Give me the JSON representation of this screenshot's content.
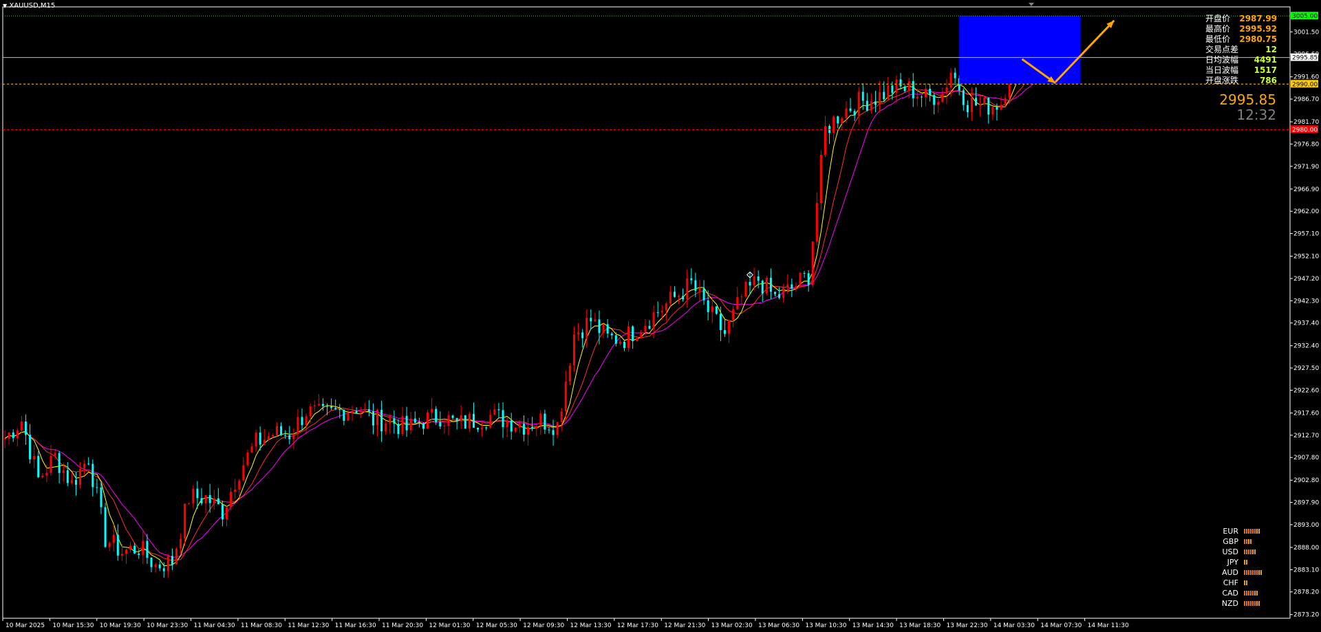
{
  "window": {
    "symbol_label": "XAUUSD,M15"
  },
  "colors": {
    "background": "#000000",
    "bull_candle": "#ff0000",
    "bear_candle": "#00ffff",
    "ma_fast": "#ffff00",
    "ma_mid": "#ff3030",
    "ma_slow": "#ff00ff",
    "axis": "#ffffff",
    "target_box": "#0000ff",
    "arrow": "#ffa500",
    "upper_level": "#00ff00",
    "mid_level": "#ffcc00",
    "lower_level": "#ff0000",
    "bid_line": "#c0c0c0"
  },
  "info_panel": [
    {
      "label": "开盘价",
      "value": "2987.99",
      "color": "#ffa500"
    },
    {
      "label": "最高价",
      "value": "2995.92",
      "color": "#ffa500"
    },
    {
      "label": "最低价",
      "value": "2980.75",
      "color": "#ffa500"
    },
    {
      "label": "交易点差",
      "value": "12",
      "color": "#ccff33"
    },
    {
      "label": "日均波幅",
      "value": "4491",
      "color": "#ccff33"
    },
    {
      "label": "当日波幅",
      "value": "1517",
      "color": "#ccff33"
    },
    {
      "label": "开盘涨跌",
      "value": "786",
      "color": "#ccff33"
    }
  ],
  "current_price": "2995.85",
  "countdown": "12:32",
  "currency_strength": [
    {
      "name": "EUR",
      "bars": 8
    },
    {
      "name": "GBP",
      "bars": 4
    },
    {
      "name": "USD",
      "bars": 6
    },
    {
      "name": "JPY",
      "bars": 2
    },
    {
      "name": "AUD",
      "bars": 9
    },
    {
      "name": "CHF",
      "bars": 2
    },
    {
      "name": "CAD",
      "bars": 7
    },
    {
      "name": "NZD",
      "bars": 8
    }
  ],
  "chart_data": {
    "type": "candlestick",
    "symbol": "XAUUSD",
    "timeframe": "M15",
    "ylim": [
      2872.4,
      3007.0
    ],
    "y_ticks": [
      "3001.50",
      "2996.60",
      "2991.60",
      "2986.70",
      "2981.70",
      "2976.80",
      "2971.90",
      "2966.90",
      "2962.00",
      "2957.10",
      "2952.10",
      "2947.20",
      "2942.30",
      "2937.40",
      "2932.40",
      "2927.50",
      "2922.60",
      "2917.60",
      "2912.70",
      "2907.80",
      "2902.80",
      "2897.90",
      "2893.00",
      "2888.00",
      "2883.10",
      "2878.20",
      "2873.20"
    ],
    "x_ticks": [
      "10 Mar 2025",
      "10 Mar 15:30",
      "10 Mar 19:30",
      "10 Mar 23:30",
      "11 Mar 04:30",
      "11 Mar 08:30",
      "11 Mar 12:30",
      "11 Mar 16:30",
      "11 Mar 20:30",
      "12 Mar 01:30",
      "12 Mar 05:30",
      "12 Mar 09:30",
      "12 Mar 13:30",
      "12 Mar 17:30",
      "12 Mar 21:30",
      "13 Mar 02:30",
      "13 Mar 06:30",
      "13 Mar 10:30",
      "13 Mar 14:30",
      "13 Mar 18:30",
      "13 Mar 22:30",
      "14 Mar 03:30",
      "14 Mar 07:30",
      "14 Mar 11:30"
    ],
    "levels": [
      {
        "name": "upper",
        "value": 3005.0,
        "label": "3005.00",
        "style": "dotted"
      },
      {
        "name": "bid",
        "value": 2995.85,
        "label": "2995.85",
        "style": "solid"
      },
      {
        "name": "mid",
        "value": 2990.0,
        "label": "2990.00",
        "style": "dashed"
      },
      {
        "name": "lower",
        "value": 2980.0,
        "label": "2980.00",
        "style": "dashed"
      }
    ],
    "target_box": {
      "bar_from": 228,
      "bar_to": 257,
      "price_low": 2990.0,
      "price_high": 3005.0
    },
    "arrows": [
      {
        "from_bar": 243,
        "from_price": 2995.5,
        "to_bar": 251,
        "to_price": 2990.2
      },
      {
        "from_bar": 251,
        "from_price": 2990.5,
        "to_bar": 265,
        "to_price": 3004.0
      }
    ],
    "marker": {
      "bar": 178,
      "price": 2948.0
    },
    "waypoints": [
      [
        0,
        2912
      ],
      [
        4,
        2916
      ],
      [
        8,
        2903
      ],
      [
        12,
        2908
      ],
      [
        16,
        2902
      ],
      [
        20,
        2908
      ],
      [
        24,
        2890
      ],
      [
        28,
        2887
      ],
      [
        32,
        2888
      ],
      [
        36,
        2884
      ],
      [
        40,
        2885
      ],
      [
        44,
        2899
      ],
      [
        48,
        2899
      ],
      [
        52,
        2896
      ],
      [
        56,
        2905
      ],
      [
        60,
        2911
      ],
      [
        64,
        2913
      ],
      [
        68,
        2913
      ],
      [
        72,
        2918
      ],
      [
        76,
        2917
      ],
      [
        80,
        2918
      ],
      [
        84,
        2919
      ],
      [
        88,
        2916
      ],
      [
        92,
        2916
      ],
      [
        96,
        2914
      ],
      [
        100,
        2916
      ],
      [
        104,
        2917
      ],
      [
        108,
        2915
      ],
      [
        112,
        2916
      ],
      [
        116,
        2917
      ],
      [
        120,
        2916
      ],
      [
        124,
        2915
      ],
      [
        128,
        2916
      ],
      [
        132,
        2915
      ],
      [
        136,
        2935
      ],
      [
        140,
        2938
      ],
      [
        144,
        2934
      ],
      [
        148,
        2934
      ],
      [
        152,
        2937
      ],
      [
        156,
        2940
      ],
      [
        160,
        2943
      ],
      [
        164,
        2946
      ],
      [
        168,
        2940
      ],
      [
        172,
        2935
      ],
      [
        176,
        2943
      ],
      [
        180,
        2947
      ],
      [
        184,
        2943
      ],
      [
        188,
        2945
      ],
      [
        192,
        2948
      ],
      [
        196,
        2980
      ],
      [
        200,
        2984
      ],
      [
        204,
        2986
      ],
      [
        208,
        2987
      ],
      [
        212,
        2989
      ],
      [
        216,
        2989
      ],
      [
        220,
        2987
      ],
      [
        224,
        2988
      ],
      [
        226,
        2993
      ],
      [
        230,
        2986
      ],
      [
        234,
        2985
      ],
      [
        238,
        2986
      ],
      [
        241,
        2995.85
      ]
    ]
  }
}
